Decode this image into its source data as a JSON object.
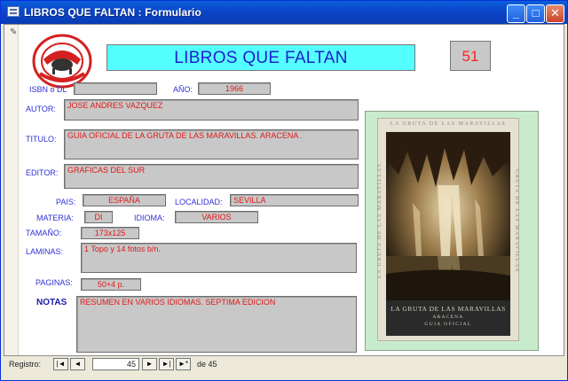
{
  "window": {
    "title": "LIBROS QUE FALTAN : Formulario",
    "buttons": {
      "minimize": "_",
      "maximize": "□",
      "close": "✕"
    }
  },
  "header": {
    "title": "LIBROS QUE FALTAN",
    "record_number": "51"
  },
  "fields": {
    "isbn": {
      "label": "ISBN o DL",
      "value": ""
    },
    "anio": {
      "label": "AÑO:",
      "value": "1966"
    },
    "autor": {
      "label": "AUTOR:",
      "value": "JOSE ANDRES VAZQUEZ"
    },
    "titulo": {
      "label": "TITULO:",
      "value": "GUIA OFICIAL DE LA GRUTA DE LAS MARAVILLAS. ARACENA ."
    },
    "editor": {
      "label": "EDITOR:",
      "value": "GRAFICAS DEL SUR"
    },
    "pais": {
      "label": "PAIS:",
      "value": "ESPAÑA"
    },
    "localidad": {
      "label": "LOCALIDAD:",
      "value": "SEVILLA"
    },
    "materia": {
      "label": "MATERIA:",
      "value": "DI"
    },
    "idioma": {
      "label": "IDIOMA:",
      "value": "VARIOS"
    },
    "tamano": {
      "label": "TAMAÑO:",
      "value": "173x125"
    },
    "laminas": {
      "label": "LAMINAS:",
      "value": "1 Topo y 14 fotos b/n."
    },
    "paginas": {
      "label": "PAGINAS:",
      "value": "50+4 p."
    },
    "notas": {
      "label": "NOTAS",
      "value": "RESUMEN EN VARIOS IDIOMAS. SEPTIMA EDICION"
    }
  },
  "cover": {
    "top_text": "LA GRUTA DE LAS MARAVILLAS",
    "side_left": "LA GRUTA DE LAS MARAVILLAS",
    "side_right": "GRUTA DE LAS MARAVILLAS",
    "band_title": "LA GRUTA DE LAS MARAVILLAS",
    "band_place": "ARACENA",
    "band_sub": "GUIA OFICIAL"
  },
  "navigation": {
    "label": "Registro:",
    "current": "45",
    "of_text": "de 45",
    "first": "|◄",
    "prev": "◄",
    "next": "►",
    "last": "►|",
    "new": "►*"
  },
  "colors": {
    "title_bg": "#54ffff",
    "title_fg": "#2020cc",
    "field_bg": "#c8c8c8",
    "value_fg": "#e01818",
    "label_fg": "#3030d8",
    "photo_bg": "#c8ebcc"
  }
}
